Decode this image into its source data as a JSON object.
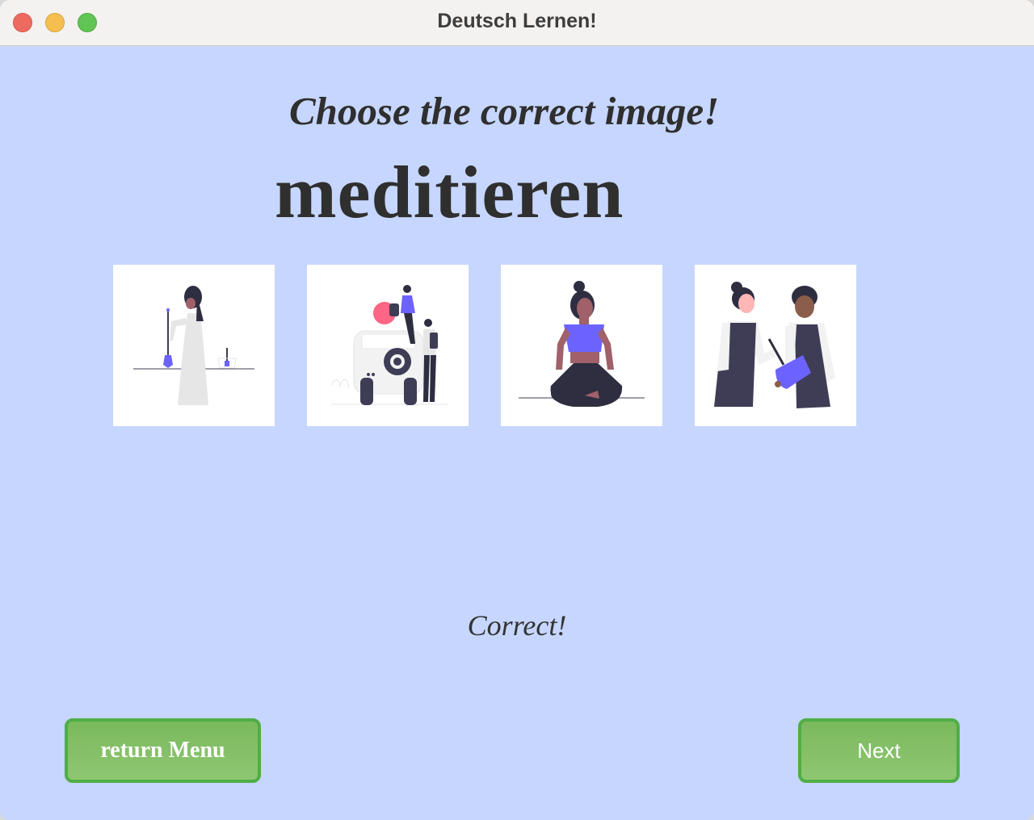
{
  "window": {
    "title": "Deutsch Lernen!"
  },
  "quiz": {
    "prompt": "Choose the correct image!",
    "word": "meditieren",
    "feedback": "Correct!",
    "choices": [
      {
        "icon": "scientist-pipette-illustration"
      },
      {
        "icon": "travelers-car-illustration"
      },
      {
        "icon": "woman-meditating-illustration"
      },
      {
        "icon": "chefs-cooking-illustration"
      }
    ]
  },
  "buttons": {
    "return_label": "return Menu",
    "next_label": "Next"
  },
  "colors": {
    "background": "#c6d6fe",
    "button_fill": "#7bb95d",
    "button_border": "#4fae45",
    "accent_purple": "#6c63ff",
    "accent_pink": "#ff6584"
  }
}
